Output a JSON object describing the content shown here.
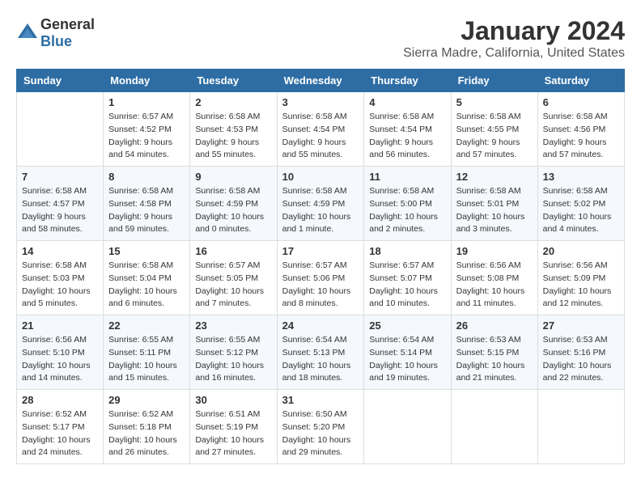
{
  "header": {
    "logo": {
      "text_general": "General",
      "text_blue": "Blue"
    },
    "month": "January 2024",
    "location": "Sierra Madre, California, United States"
  },
  "days_of_week": [
    "Sunday",
    "Monday",
    "Tuesday",
    "Wednesday",
    "Thursday",
    "Friday",
    "Saturday"
  ],
  "weeks": [
    [
      {
        "day": "",
        "info": ""
      },
      {
        "day": "1",
        "info": "Sunrise: 6:57 AM\nSunset: 4:52 PM\nDaylight: 9 hours\nand 54 minutes."
      },
      {
        "day": "2",
        "info": "Sunrise: 6:58 AM\nSunset: 4:53 PM\nDaylight: 9 hours\nand 55 minutes."
      },
      {
        "day": "3",
        "info": "Sunrise: 6:58 AM\nSunset: 4:54 PM\nDaylight: 9 hours\nand 55 minutes."
      },
      {
        "day": "4",
        "info": "Sunrise: 6:58 AM\nSunset: 4:54 PM\nDaylight: 9 hours\nand 56 minutes."
      },
      {
        "day": "5",
        "info": "Sunrise: 6:58 AM\nSunset: 4:55 PM\nDaylight: 9 hours\nand 57 minutes."
      },
      {
        "day": "6",
        "info": "Sunrise: 6:58 AM\nSunset: 4:56 PM\nDaylight: 9 hours\nand 57 minutes."
      }
    ],
    [
      {
        "day": "7",
        "info": "Sunrise: 6:58 AM\nSunset: 4:57 PM\nDaylight: 9 hours\nand 58 minutes."
      },
      {
        "day": "8",
        "info": "Sunrise: 6:58 AM\nSunset: 4:58 PM\nDaylight: 9 hours\nand 59 minutes."
      },
      {
        "day": "9",
        "info": "Sunrise: 6:58 AM\nSunset: 4:59 PM\nDaylight: 10 hours\nand 0 minutes."
      },
      {
        "day": "10",
        "info": "Sunrise: 6:58 AM\nSunset: 4:59 PM\nDaylight: 10 hours\nand 1 minute."
      },
      {
        "day": "11",
        "info": "Sunrise: 6:58 AM\nSunset: 5:00 PM\nDaylight: 10 hours\nand 2 minutes."
      },
      {
        "day": "12",
        "info": "Sunrise: 6:58 AM\nSunset: 5:01 PM\nDaylight: 10 hours\nand 3 minutes."
      },
      {
        "day": "13",
        "info": "Sunrise: 6:58 AM\nSunset: 5:02 PM\nDaylight: 10 hours\nand 4 minutes."
      }
    ],
    [
      {
        "day": "14",
        "info": "Sunrise: 6:58 AM\nSunset: 5:03 PM\nDaylight: 10 hours\nand 5 minutes."
      },
      {
        "day": "15",
        "info": "Sunrise: 6:58 AM\nSunset: 5:04 PM\nDaylight: 10 hours\nand 6 minutes."
      },
      {
        "day": "16",
        "info": "Sunrise: 6:57 AM\nSunset: 5:05 PM\nDaylight: 10 hours\nand 7 minutes."
      },
      {
        "day": "17",
        "info": "Sunrise: 6:57 AM\nSunset: 5:06 PM\nDaylight: 10 hours\nand 8 minutes."
      },
      {
        "day": "18",
        "info": "Sunrise: 6:57 AM\nSunset: 5:07 PM\nDaylight: 10 hours\nand 10 minutes."
      },
      {
        "day": "19",
        "info": "Sunrise: 6:56 AM\nSunset: 5:08 PM\nDaylight: 10 hours\nand 11 minutes."
      },
      {
        "day": "20",
        "info": "Sunrise: 6:56 AM\nSunset: 5:09 PM\nDaylight: 10 hours\nand 12 minutes."
      }
    ],
    [
      {
        "day": "21",
        "info": "Sunrise: 6:56 AM\nSunset: 5:10 PM\nDaylight: 10 hours\nand 14 minutes."
      },
      {
        "day": "22",
        "info": "Sunrise: 6:55 AM\nSunset: 5:11 PM\nDaylight: 10 hours\nand 15 minutes."
      },
      {
        "day": "23",
        "info": "Sunrise: 6:55 AM\nSunset: 5:12 PM\nDaylight: 10 hours\nand 16 minutes."
      },
      {
        "day": "24",
        "info": "Sunrise: 6:54 AM\nSunset: 5:13 PM\nDaylight: 10 hours\nand 18 minutes."
      },
      {
        "day": "25",
        "info": "Sunrise: 6:54 AM\nSunset: 5:14 PM\nDaylight: 10 hours\nand 19 minutes."
      },
      {
        "day": "26",
        "info": "Sunrise: 6:53 AM\nSunset: 5:15 PM\nDaylight: 10 hours\nand 21 minutes."
      },
      {
        "day": "27",
        "info": "Sunrise: 6:53 AM\nSunset: 5:16 PM\nDaylight: 10 hours\nand 22 minutes."
      }
    ],
    [
      {
        "day": "28",
        "info": "Sunrise: 6:52 AM\nSunset: 5:17 PM\nDaylight: 10 hours\nand 24 minutes."
      },
      {
        "day": "29",
        "info": "Sunrise: 6:52 AM\nSunset: 5:18 PM\nDaylight: 10 hours\nand 26 minutes."
      },
      {
        "day": "30",
        "info": "Sunrise: 6:51 AM\nSunset: 5:19 PM\nDaylight: 10 hours\nand 27 minutes."
      },
      {
        "day": "31",
        "info": "Sunrise: 6:50 AM\nSunset: 5:20 PM\nDaylight: 10 hours\nand 29 minutes."
      },
      {
        "day": "",
        "info": ""
      },
      {
        "day": "",
        "info": ""
      },
      {
        "day": "",
        "info": ""
      }
    ]
  ]
}
